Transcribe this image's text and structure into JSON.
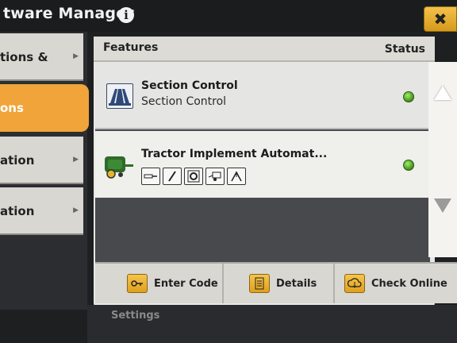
{
  "window": {
    "title": "tware Manager",
    "info_icon": "info-icon",
    "close_label": "✖"
  },
  "sidebar": {
    "items": [
      {
        "label": "tions &",
        "active": false
      },
      {
        "label": "ons",
        "active": true
      },
      {
        "label": "ation",
        "active": false
      },
      {
        "label": "ation",
        "active": false
      }
    ]
  },
  "table": {
    "header": {
      "features": "Features",
      "status": "Status"
    },
    "rows": [
      {
        "title": "Section Control",
        "subtitle": "Section Control",
        "icon": "section-control-icon",
        "status": "active",
        "status_color": "#5fcf2a"
      },
      {
        "title": "Tractor Implement Automat...",
        "icon": "baler-icon",
        "capability_icons": [
          "cylinder-icon",
          "pencil-icon",
          "gear-settings-icon",
          "baler-tow-icon",
          "steering-icon"
        ],
        "status": "active",
        "status_color": "#5fcf2a"
      }
    ]
  },
  "footer": {
    "enter_code": "Enter Code",
    "details": "Details",
    "check_online": "Check Online"
  },
  "bottom": {
    "partial_label": "Settings"
  }
}
